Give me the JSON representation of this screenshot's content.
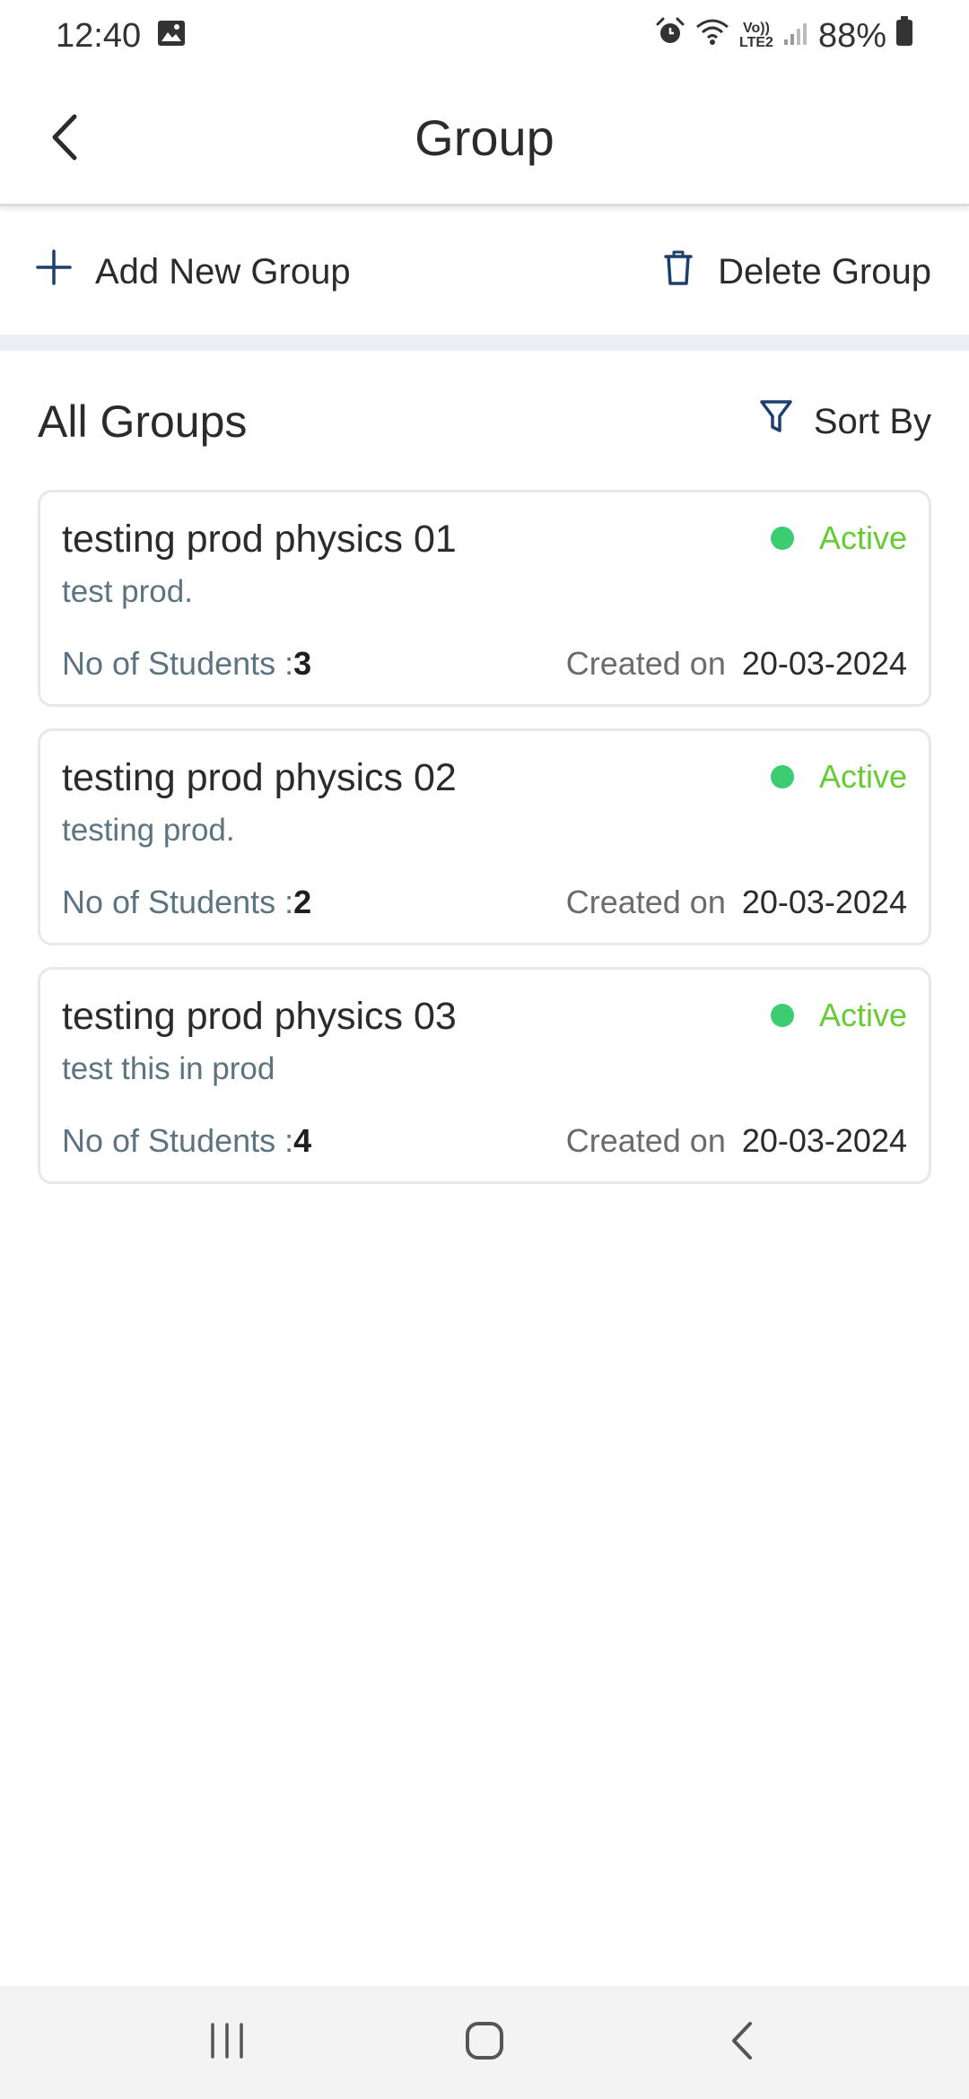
{
  "status_bar": {
    "time": "12:40",
    "network_top": "Vo))",
    "network_bottom": "LTE2",
    "battery": "88%"
  },
  "header": {
    "title": "Group"
  },
  "actions": {
    "add_label": "Add New Group",
    "delete_label": "Delete Group"
  },
  "section": {
    "title": "All Groups",
    "sort_label": "Sort By"
  },
  "groups": [
    {
      "name": "testing prod physics 01",
      "description": "test prod.",
      "status": "Active",
      "students_label": "No of Students :",
      "students_count": "3",
      "created_label": "Created on",
      "created_date": "20-03-2024"
    },
    {
      "name": "testing prod physics 02",
      "description": "testing prod.",
      "status": "Active",
      "students_label": "No of Students :",
      "students_count": "2",
      "created_label": "Created on",
      "created_date": "20-03-2024"
    },
    {
      "name": "testing prod physics 03",
      "description": "test this in prod",
      "status": "Active",
      "students_label": "No of Students :",
      "students_count": "4",
      "created_label": "Created on",
      "created_date": "20-03-2024"
    }
  ],
  "colors": {
    "active_dot": "#3ccc72",
    "active_text": "#66cc33",
    "icon_blue": "#1c3f6e",
    "muted_text": "#5c7380"
  },
  "icons": {
    "gallery": "image-icon",
    "alarm": "alarm-icon",
    "wifi": "wifi-icon",
    "signal": "signal-icon",
    "battery": "battery-icon",
    "back": "chevron-left-icon",
    "add": "plus-icon",
    "delete": "trash-icon",
    "sort": "filter-icon",
    "nav_recents": "recents-icon",
    "nav_home": "home-icon",
    "nav_back": "back-icon"
  }
}
